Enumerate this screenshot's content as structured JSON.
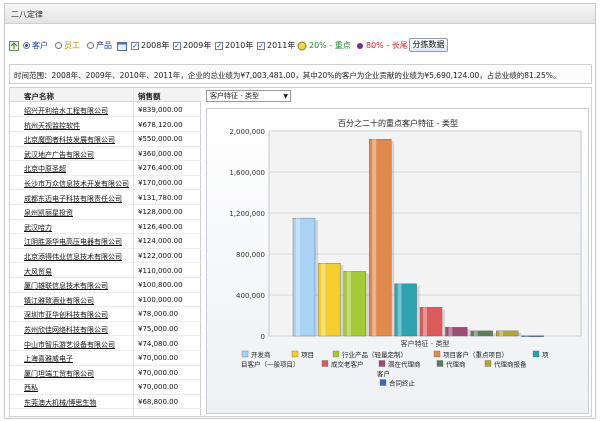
{
  "window": {
    "title": "二八定律"
  },
  "toolbar": {
    "radios": [
      {
        "label": "客户",
        "selected": true,
        "color": "#1a3fb0"
      },
      {
        "label": "员工",
        "selected": false,
        "color": "#c78a00"
      },
      {
        "label": "产品",
        "selected": false,
        "color": "#1a3fb0"
      }
    ],
    "years": [
      {
        "label": "2008年",
        "checked": true
      },
      {
        "label": "2009年",
        "checked": true
      },
      {
        "label": "2010年",
        "checked": true
      },
      {
        "label": "2011年",
        "checked": true
      }
    ],
    "range_green": "20% - 重点",
    "range_red": "80% - 长尾",
    "analyze_button": "分拣数据"
  },
  "summary": {
    "text": "时间范围：2008年、2009年、2010年、2011年，企业的总业绩为¥7,003,481.00，其中20%的客户为企业贡献的业绩为¥5,690,124.00，占总业绩的81.25%。"
  },
  "table": {
    "headers": {
      "name": "客户名称",
      "sales": "销售额"
    },
    "rows": [
      {
        "name": "绍兴开利给水工程有限公司",
        "sales": "¥839,000.00"
      },
      {
        "name": "杭州天视监控软件",
        "sales": "¥678,120.00"
      },
      {
        "name": "北京魔图者科技发展有限公司",
        "sales": "¥550,000.00"
      },
      {
        "name": "武汉地产广告有限公司",
        "sales": "¥360,000.00"
      },
      {
        "name": "北京中原圣超",
        "sales": "¥276,400.00"
      },
      {
        "name": "长沙市万众信息技术开发有限公司",
        "sales": "¥170,000.00"
      },
      {
        "name": "成都东迈电子科技有限责任公司",
        "sales": "¥131,780.00"
      },
      {
        "name": "泉州凯丽星投资",
        "sales": "¥128,000.00"
      },
      {
        "name": "武汉哈力",
        "sales": "¥126,400.00"
      },
      {
        "name": "江阴胜源华电高压电器有限公司",
        "sales": "¥124,000.00"
      },
      {
        "name": "北京添得伟业信息技术有限公司",
        "sales": "¥122,000.00"
      },
      {
        "name": "大风贸易",
        "sales": "¥110,000.00"
      },
      {
        "name": "厦门雄联信息技术有限公司",
        "sales": "¥100,800.00"
      },
      {
        "name": "镇江雅致酒业有限公司",
        "sales": "¥100,000.00"
      },
      {
        "name": "深圳市亚华创科技有限公司",
        "sales": "¥78,000.00"
      },
      {
        "name": "苏州欣佳网络科技有限公司",
        "sales": "¥75,000.00"
      },
      {
        "name": "中山市智乐游艺设备有限公司",
        "sales": "¥74,080.00"
      },
      {
        "name": "上海喜雅威电子",
        "sales": "¥70,000.00"
      },
      {
        "name": "厦门坦端工贸有限公司",
        "sales": "¥70,000.00"
      },
      {
        "name": "西私",
        "sales": "¥70,000.00"
      },
      {
        "name": "东莞澳大机械/博思生物",
        "sales": "¥68,800.00"
      }
    ]
  },
  "chart_selector": {
    "value": "客户特征 - 类型"
  },
  "chart_data": {
    "type": "bar",
    "title": "百分之二十的重点客户特征 - 类型",
    "xlabel": "客户特征 - 类型",
    "ylabel": "",
    "ylim": [
      0,
      2000000
    ],
    "yticks": [
      "0",
      "400,000",
      "800,000",
      "1,200,000",
      "1,600,000",
      "2,000,000"
    ],
    "grid": true,
    "legend_position": "bottom",
    "series": [
      {
        "name": "开发商",
        "value": 1150000,
        "color": "#a9d3f5"
      },
      {
        "name": "项目",
        "value": 710000,
        "color": "#f2cf2e"
      },
      {
        "name": "行业产品（轻量定制）",
        "value": 630000,
        "color": "#a6c93a"
      },
      {
        "name": "项目客户（重点项目）",
        "value": 1920000,
        "color": "#e08a4e"
      },
      {
        "name": "项目客户（一般项目）",
        "value": 510000,
        "color": "#2da3b0"
      },
      {
        "name": "成交老客户",
        "value": 280000,
        "color": "#dd5a5a"
      },
      {
        "name": "潜在代理商",
        "value": 85000,
        "color": "#9c4d77"
      },
      {
        "name": "代理商",
        "value": 50000,
        "color": "#5c7e58"
      },
      {
        "name": "代理商报备客户",
        "value": 50000,
        "color": "#b3a533"
      },
      {
        "name": "合同终止",
        "value": 3000,
        "color": "#3d68b8"
      }
    ],
    "legend_lines": [
      [
        {
          "name": "开发商",
          "color": "#a9d3f5",
          "lx": 44
        },
        {
          "name": "项目",
          "color": "#f2cf2e",
          "lx": 94
        },
        {
          "name": "行业产品（轻量定制）",
          "color": "#a6c93a",
          "lx": 135
        },
        {
          "name": "项目客户（重点项目）",
          "color": "#e08a4e",
          "lx": 236
        },
        {
          "name": "项",
          "color": "#2da3b0",
          "lx": 335
        }
      ],
      [
        {
          "name": "目客户（一般项目）",
          "color": "",
          "lx": 34
        },
        {
          "name": "成交老客户",
          "color": "#dd5a5a",
          "lx": 124
        },
        {
          "name": "潜在代理商",
          "color": "#9c4d77",
          "lx": 181
        },
        {
          "name": "代理商",
          "color": "#5c7e58",
          "lx": 239
        },
        {
          "name": "代理商报备",
          "color": "#b3a533",
          "lx": 287
        }
      ],
      [
        {
          "name": "客户",
          "color": "",
          "lx": 170
        }
      ],
      [
        {
          "name": "合同终止",
          "color": "#3d68b8",
          "lx": 182
        }
      ]
    ]
  }
}
